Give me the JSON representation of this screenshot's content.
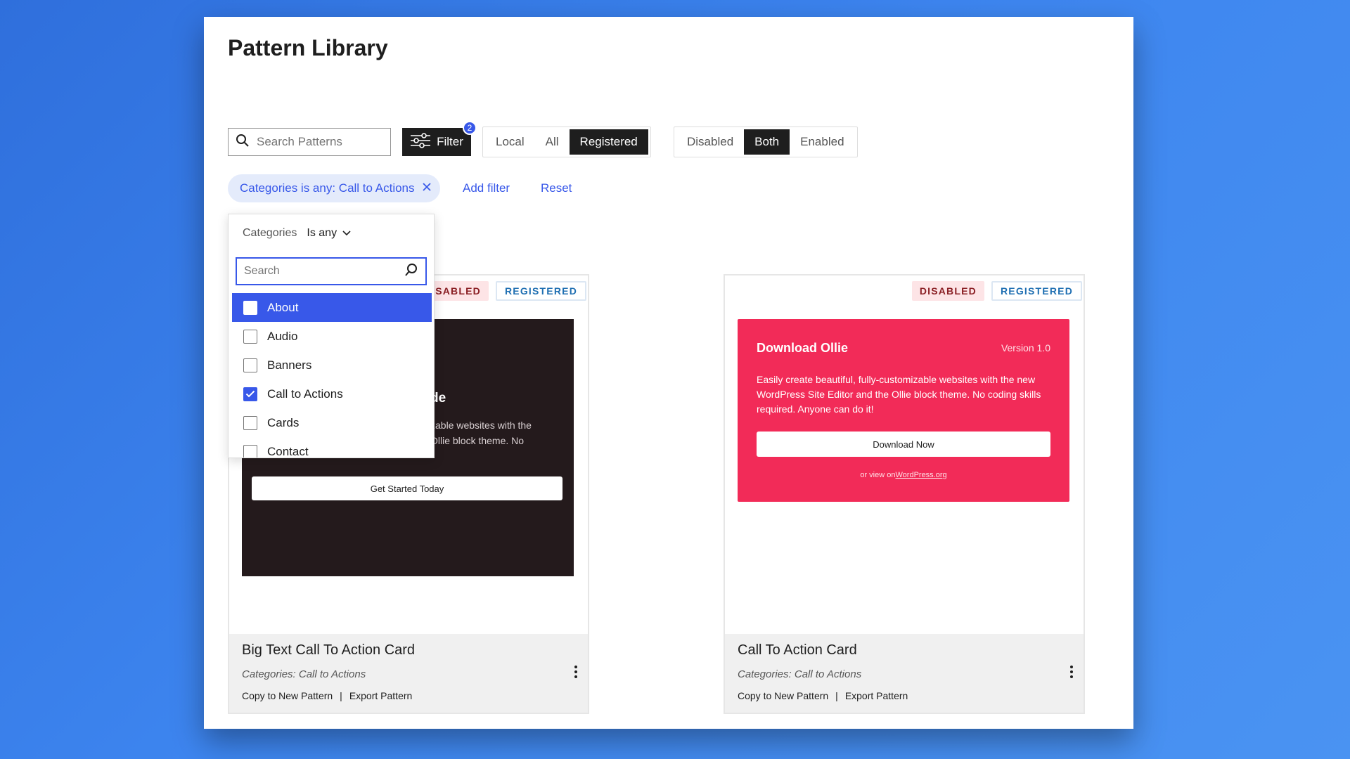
{
  "page": {
    "title": "Pattern Library"
  },
  "toolbar": {
    "search_placeholder": "Search Patterns",
    "filter_label": "Filter",
    "filter_count": "2",
    "source_options": [
      "Local",
      "All",
      "Registered"
    ],
    "source_active": "Registered",
    "status_options": [
      "Disabled",
      "Both",
      "Enabled"
    ],
    "status_active": "Both"
  },
  "filters": {
    "chip_label": "Categories is any: Call to Actions",
    "add_filter": "Add filter",
    "reset": "Reset"
  },
  "dropdown": {
    "field": "Categories",
    "operator": "Is any",
    "search_placeholder": "Search",
    "items": [
      {
        "label": "About",
        "checked": false,
        "highlighted": true
      },
      {
        "label": "Audio",
        "checked": false
      },
      {
        "label": "Banners",
        "checked": false
      },
      {
        "label": "Call to Actions",
        "checked": true
      },
      {
        "label": "Cards",
        "checked": false
      },
      {
        "label": "Contact",
        "checked": false
      }
    ]
  },
  "cards": [
    {
      "badges": {
        "disabled": "DISABLED",
        "registered": "REGISTERED"
      },
      "preview": {
        "heading_fragment": "de",
        "body_fragment": "zable websites with the\nOllie block theme. No",
        "button": "Get Started Today"
      },
      "title": "Big Text Call To Action Card",
      "categories": "Categories: Call to Actions",
      "copy_action": "Copy to New Pattern",
      "separator": "|",
      "export_action": "Export Pattern"
    },
    {
      "badges": {
        "disabled": "DISABLED",
        "registered": "REGISTERED"
      },
      "preview": {
        "title": "Download Ollie",
        "version": "Version 1.0",
        "body": "Easily create beautiful, fully-customizable websites with the new WordPress Site Editor and the Ollie block theme. No coding skills required. Anyone can do it!",
        "button": "Download Now",
        "footer_prefix": "or view on",
        "footer_link": "WordPress.org"
      },
      "title": "Call To Action Card",
      "categories": "Categories: Call to Actions",
      "copy_action": "Copy to New Pattern",
      "separator": "|",
      "export_action": "Export Pattern"
    }
  ],
  "colors": {
    "accent": "#3858e9",
    "dark": "#1e1e1e",
    "cta_red": "#f22b58",
    "preview_dark": "#241a1c"
  }
}
